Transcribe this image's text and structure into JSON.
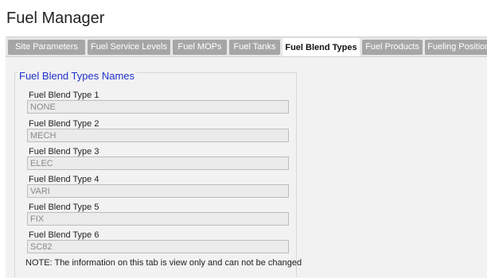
{
  "app": {
    "title": "Fuel Manager"
  },
  "tabs": [
    {
      "label": "Site Parameters",
      "active": false
    },
    {
      "label": "Fuel Service Levels",
      "active": false
    },
    {
      "label": "Fuel MOPs",
      "active": false
    },
    {
      "label": "Fuel Tanks",
      "active": false
    },
    {
      "label": "Fuel Blend Types",
      "active": true
    },
    {
      "label": "Fuel Products",
      "active": false
    },
    {
      "label": "Fueling Positions",
      "active": false
    }
  ],
  "section": {
    "title": "Fuel Blend Types Names",
    "fields": [
      {
        "label": "Fuel Blend Type 1",
        "value": "NONE"
      },
      {
        "label": "Fuel Blend Type 2",
        "value": "MECH"
      },
      {
        "label": "Fuel Blend Type 3",
        "value": "ELEC"
      },
      {
        "label": "Fuel Blend Type 4",
        "value": "VARI"
      },
      {
        "label": "Fuel Blend Type 5",
        "value": "FIX"
      },
      {
        "label": "Fuel Blend Type 6",
        "value": "SC82"
      }
    ],
    "note": "NOTE: The information on this tab is view only and can not be changed"
  },
  "colors": {
    "accent_title": "#2233cc",
    "tab_inactive_bg": "#a6a6a6",
    "tab_active_bg": "#ffffff",
    "panel_bg": "#f2f2f2"
  }
}
